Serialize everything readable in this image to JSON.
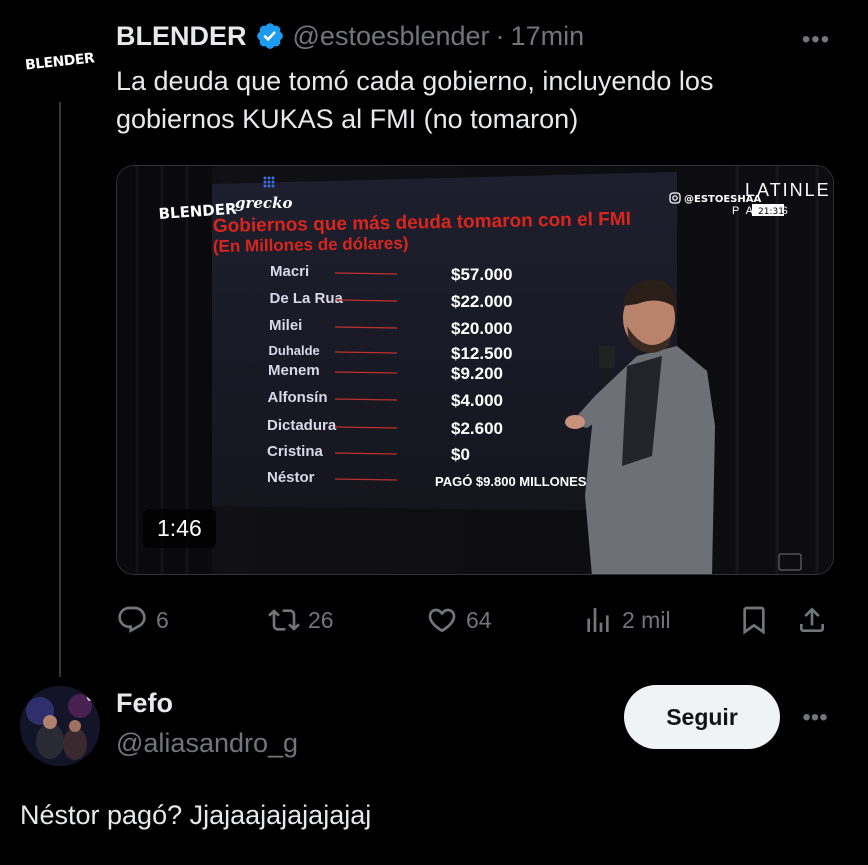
{
  "tweet": {
    "avatar_text": "BLENDER",
    "display_name": "BLENDER",
    "handle": "@estoesblender",
    "dot": "·",
    "time": "17min",
    "text": "La deuda que tomó cada gobierno, incluyendo los gobiernos KUKAS al FMI (no tomaron)",
    "media": {
      "duration": "1:46",
      "logo_blender": "BLENDER",
      "logo_grecko": "grecko",
      "instagram_handle": "@ESTOESHAA",
      "corner_text": "LATINLE",
      "corner_sub": "P    ALLAS",
      "clock": "21:31",
      "screen_title_1": "Gobiernos que más deuda tomaron con el FMI",
      "screen_title_2": "(En Millones de dólares)",
      "rows": [
        {
          "name": "Macri",
          "amount": "$57.000"
        },
        {
          "name": "De La Rua",
          "amount": "$22.000"
        },
        {
          "name": "Milei",
          "amount": "$20.000"
        },
        {
          "name": "Duhalde",
          "amount": "$12.500"
        },
        {
          "name": "Menem",
          "amount": "$9.200"
        },
        {
          "name": "Alfonsín",
          "amount": "$4.000"
        },
        {
          "name": "Dictadura",
          "amount": "$2.600"
        },
        {
          "name": "Cristina",
          "amount": "$0"
        },
        {
          "name": "Néstor",
          "amount": "PAGÓ $9.800 MILLONES"
        }
      ]
    },
    "actions": {
      "replies": "6",
      "retweets": "26",
      "likes": "64",
      "views": "2 mil"
    }
  },
  "reply": {
    "display_name": "Fefo",
    "handle": "@aliasandro_g",
    "follow_label": "Seguir",
    "text": "Néstor pagó? Jjajaajajajajajaj"
  },
  "colors": {
    "verified": "#1d9bf0",
    "muted": "#71767b",
    "text": "#e7e9ea",
    "screen_red": "#d8251d"
  }
}
